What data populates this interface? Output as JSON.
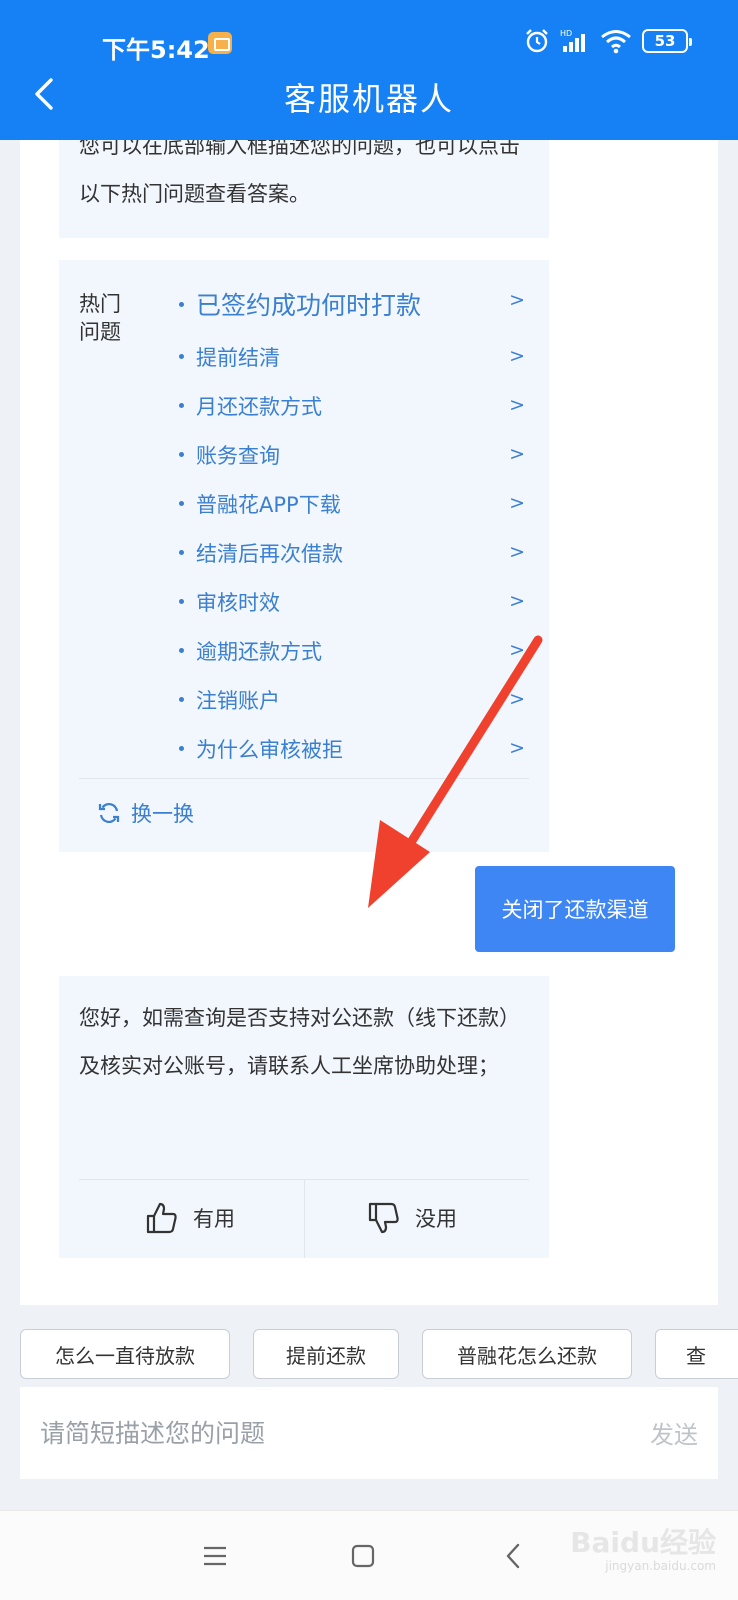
{
  "status_bar": {
    "time": "下午5:42",
    "battery": "53"
  },
  "header": {
    "title": "客服机器人"
  },
  "intro": {
    "text": "您可以在底部输入框描述您的问题，也可以点击以下热门问题查看答案。"
  },
  "hot_questions": {
    "label": "热门问题",
    "items": [
      {
        "label": "已签约成功何时打款"
      },
      {
        "label": "提前结清"
      },
      {
        "label": "月还还款方式"
      },
      {
        "label": "账务查询"
      },
      {
        "label": "普融花APP下载"
      },
      {
        "label": "结清后再次借款"
      },
      {
        "label": "审核时效"
      },
      {
        "label": "逾期还款方式"
      },
      {
        "label": "注销账户"
      },
      {
        "label": "为什么审核被拒"
      }
    ],
    "arrow": ">",
    "refresh_label": "换一换"
  },
  "user_message": {
    "text": "关闭了还款渠道"
  },
  "bot_reply": {
    "text": "您好，如需查询是否支持对公还款（线下还款）及核实对公账号，请联系人工坐席协助处理；",
    "useful_label": "有用",
    "useless_label": "没用"
  },
  "quick_replies": [
    {
      "label": "怎么一直待放款"
    },
    {
      "label": "提前还款"
    },
    {
      "label": "普融花怎么还款"
    },
    {
      "label": "查"
    }
  ],
  "input": {
    "placeholder": "请简短描述您的问题",
    "send_label": "发送"
  },
  "watermark": {
    "text": "Baidu经验",
    "sub": "jingyan.baidu.com"
  },
  "colors": {
    "header": "#1681f4",
    "link": "#3a7fd0",
    "user_bubble": "#3f86f5",
    "annotation_arrow": "#f0412e"
  }
}
